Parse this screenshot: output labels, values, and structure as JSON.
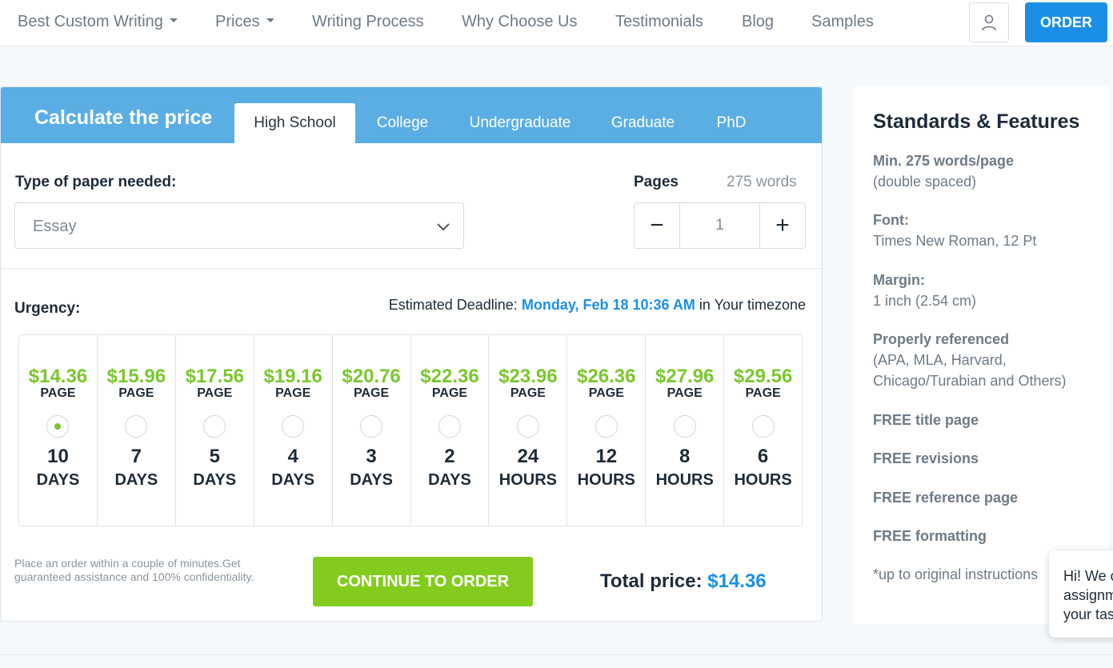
{
  "nav": {
    "items": [
      {
        "label": "Best Custom Writing",
        "dropdown": true
      },
      {
        "label": "Prices",
        "dropdown": true
      },
      {
        "label": "Writing Process",
        "dropdown": false
      },
      {
        "label": "Why Choose Us",
        "dropdown": false
      },
      {
        "label": "Testimonials",
        "dropdown": false
      },
      {
        "label": "Blog",
        "dropdown": false
      },
      {
        "label": "Samples",
        "dropdown": false
      }
    ],
    "user_icon": "user-icon",
    "order_label": "ORDER"
  },
  "calculator": {
    "title": "Calculate the price",
    "tabs": [
      "High School",
      "College",
      "Undergraduate",
      "Graduate",
      "PhD"
    ],
    "active_tab": "High School",
    "paper_label": "Type of paper needed:",
    "paper_value": "Essay",
    "pages_label": "Pages",
    "words_label": "275 words",
    "pages_value": "1",
    "minus_symbol": "−",
    "plus_symbol": "+",
    "urgency_label": "Urgency:",
    "deadline_prefix": "Estimated Deadline:",
    "deadline_date": "Monday, Feb 18 10:36 AM",
    "deadline_suffix": "in Your timezone",
    "per_label": "PAGE",
    "options": [
      {
        "price": "$14.36",
        "num": "10",
        "unit": "DAYS",
        "selected": true
      },
      {
        "price": "$15.96",
        "num": "7",
        "unit": "DAYS",
        "selected": false
      },
      {
        "price": "$17.56",
        "num": "5",
        "unit": "DAYS",
        "selected": false
      },
      {
        "price": "$19.16",
        "num": "4",
        "unit": "DAYS",
        "selected": false
      },
      {
        "price": "$20.76",
        "num": "3",
        "unit": "DAYS",
        "selected": false
      },
      {
        "price": "$22.36",
        "num": "2",
        "unit": "DAYS",
        "selected": false
      },
      {
        "price": "$23.96",
        "num": "24",
        "unit": "HOURS",
        "selected": false
      },
      {
        "price": "$26.36",
        "num": "12",
        "unit": "HOURS",
        "selected": false
      },
      {
        "price": "$27.96",
        "num": "8",
        "unit": "HOURS",
        "selected": false
      },
      {
        "price": "$29.56",
        "num": "6",
        "unit": "HOURS",
        "selected": false
      }
    ],
    "note": "Place an order within a couple of minutes.Get guaranteed assistance and 100% confidentiality.",
    "cta_label": "CONTINUE TO ORDER",
    "total_label": "Total price:",
    "total_value": "$14.36"
  },
  "side": {
    "title": "Standards & Features",
    "features": [
      {
        "bold": "Min. 275 words/page",
        "text": "(double spaced)"
      },
      {
        "bold": "Font:",
        "text": "Times New Roman, 12 Pt"
      },
      {
        "bold": "Margin:",
        "text": "1 inch (2.54 cm)"
      },
      {
        "bold": "Properly referenced",
        "text": "(APA, MLA, Harvard, Chicago/Turabian and Others)"
      },
      {
        "bold": "FREE title page",
        "text": ""
      },
      {
        "bold": "FREE revisions",
        "text": ""
      },
      {
        "bold": "FREE reference page",
        "text": ""
      },
      {
        "bold": "FREE formatting",
        "text": ""
      }
    ],
    "footnote": "*up to original instructions"
  },
  "chat": {
    "lines": [
      "Hi! We c",
      "assignm",
      "your tas"
    ]
  },
  "colors": {
    "header_blue": "#5aaee4",
    "accent_blue": "#1b8fe6",
    "price_green": "#7ac72c",
    "cta_green": "#83cc1e"
  }
}
